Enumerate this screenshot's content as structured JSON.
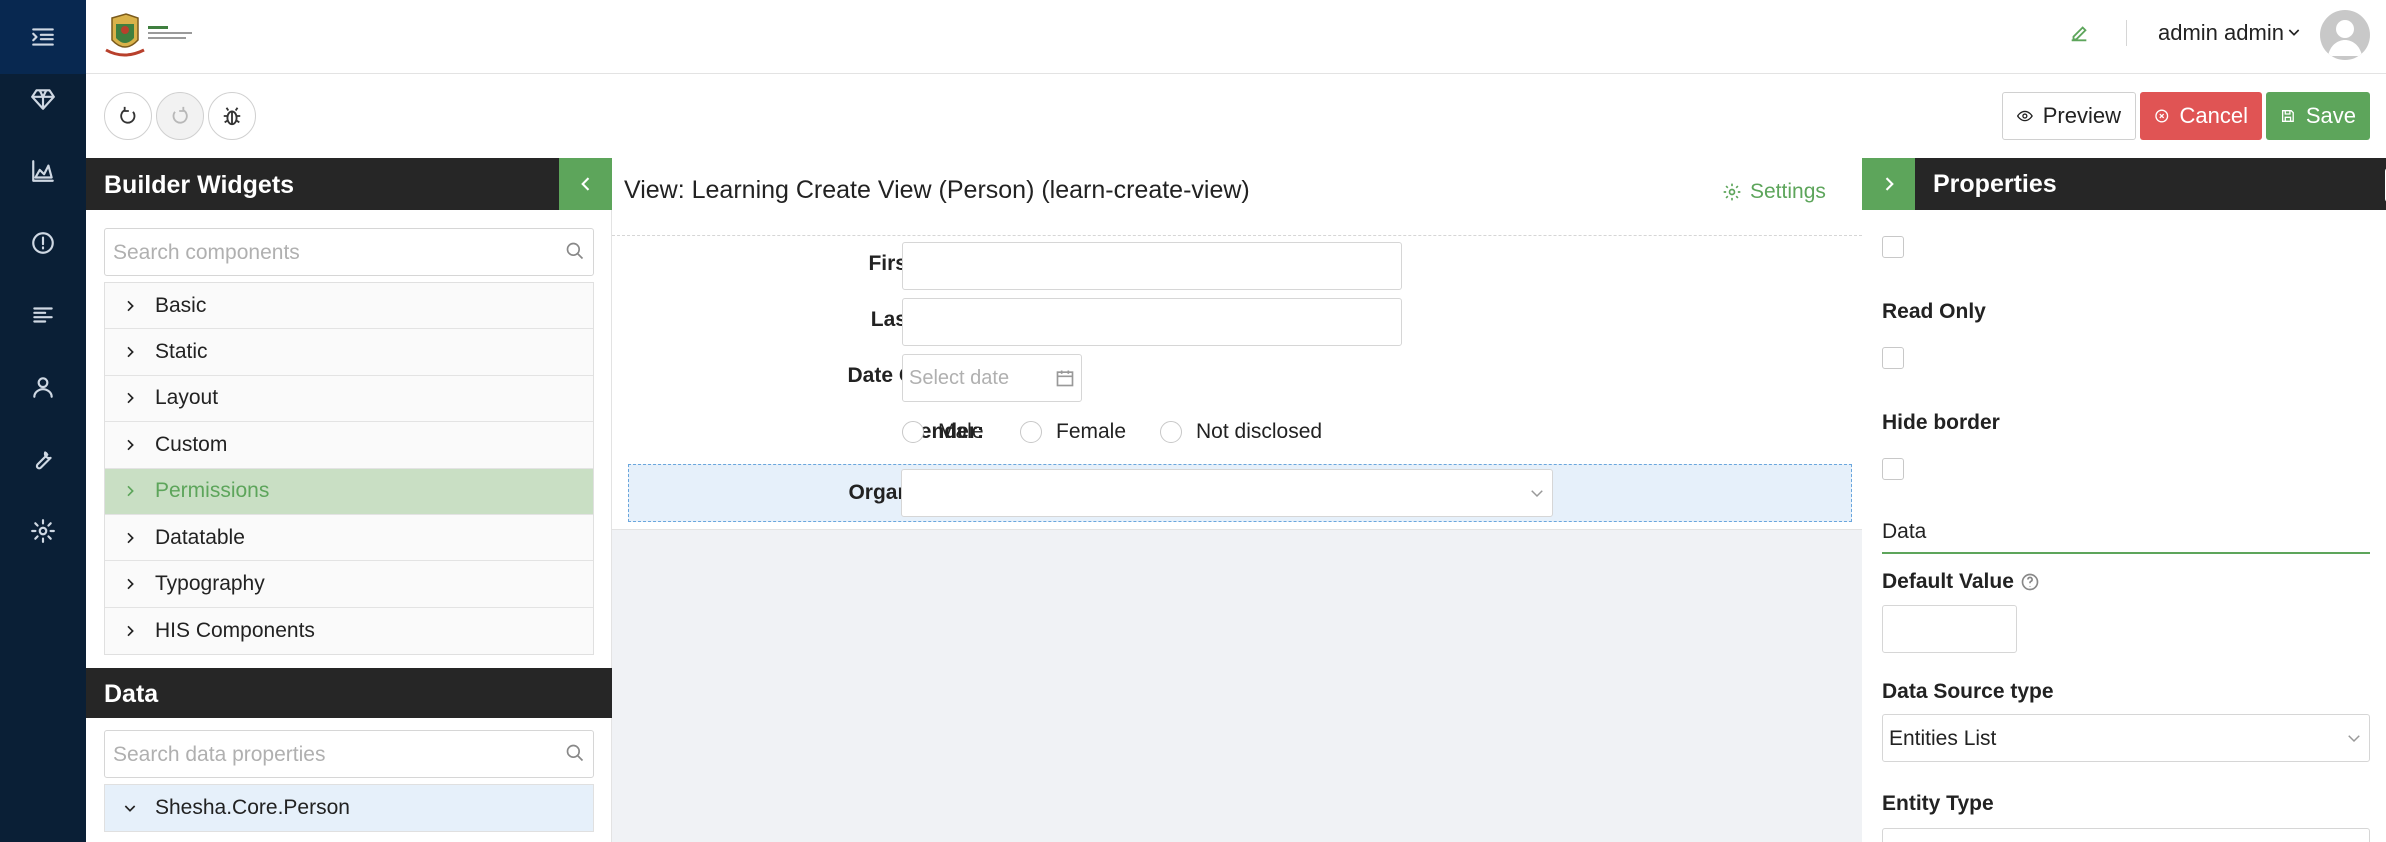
{
  "header": {
    "user_name": "admin admin"
  },
  "toolbar": {
    "preview_label": "Preview",
    "cancel_label": "Cancel",
    "save_label": "Save"
  },
  "left_panel": {
    "widgets_title": "Builder Widgets",
    "search_placeholder": "Search components",
    "groups": [
      "Basic",
      "Static",
      "Layout",
      "Custom",
      "Permissions",
      "Datatable",
      "Typography",
      "HIS Components"
    ],
    "active_group": "Permissions",
    "data_title": "Data",
    "data_search_placeholder": "Search data properties",
    "entity": "Shesha.Core.Person"
  },
  "canvas": {
    "view_title": "View: Learning Create View (Person) (learn-create-view)",
    "settings_label": "Settings",
    "fields": {
      "first_name": "First Name",
      "last_name": "Last Name",
      "dob": "Date Of Birth",
      "dob_placeholder": "Select date",
      "gender": "Gender",
      "organisation": "Organisation"
    },
    "gender_options": [
      "Male",
      "Female",
      "Not disclosed"
    ]
  },
  "properties": {
    "title": "Properties",
    "read_only": "Read Only",
    "hide_border": "Hide border",
    "data_section": "Data",
    "default_value": "Default Value",
    "data_source_type": "Data Source type",
    "data_source_value": "Entities List",
    "entity_type": "Entity Type"
  },
  "colors": {
    "nav_bg": "#0a1f36",
    "accent_green": "#5da55b",
    "danger_red": "#e05454",
    "panel_header": "#262626",
    "selected_row": "#e6f0fa"
  }
}
